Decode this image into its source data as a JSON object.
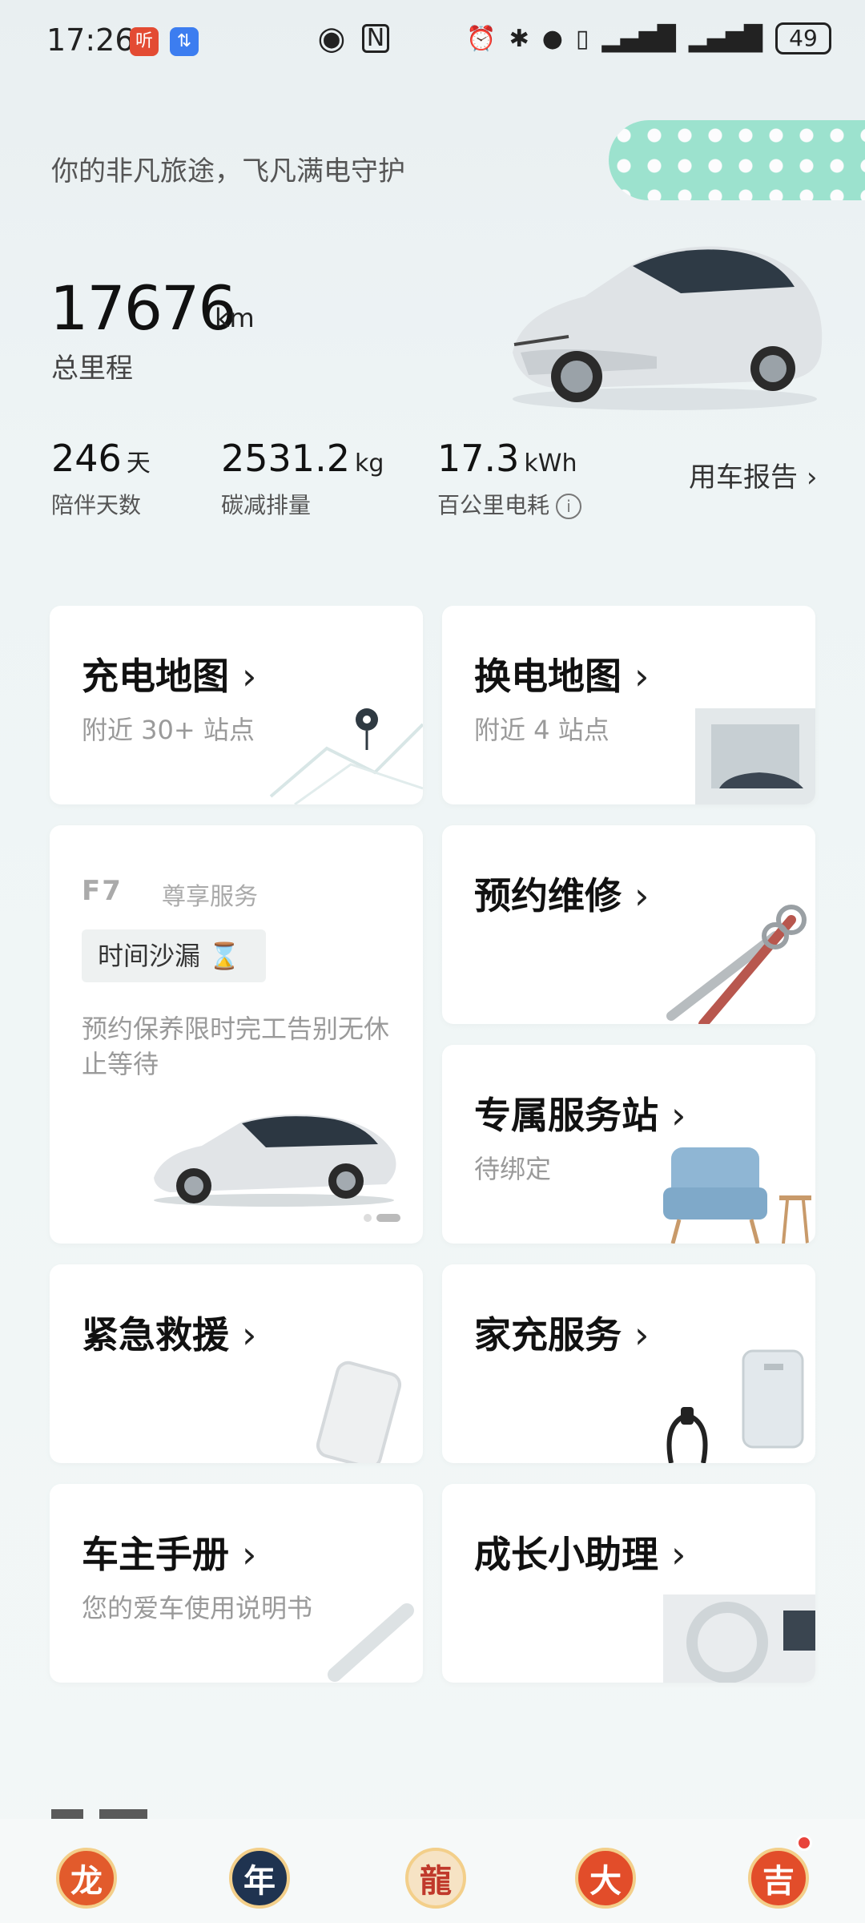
{
  "status_bar": {
    "time": "17:26",
    "battery": "49"
  },
  "header": {
    "tagline": "你的非凡旅途，飞凡满电守护",
    "mileage_value": "17676",
    "mileage_unit": "km",
    "mileage_label": "总里程"
  },
  "stats": [
    {
      "value": "246",
      "unit": "天",
      "label": "陪伴天数"
    },
    {
      "value": "2531.2",
      "unit": "kg",
      "label": "碳减排量"
    },
    {
      "value": "17.3",
      "unit": "kWh",
      "label": "百公里电耗"
    }
  ],
  "report_link": "用车报告",
  "cards": {
    "charge": {
      "title": "充电地图",
      "sub": "附近 30+ 站点"
    },
    "swap": {
      "title": "换电地图",
      "sub": "附近 4 站点"
    },
    "f7": {
      "logo": "F7",
      "tag": "尊享服务",
      "chip": "时间沙漏",
      "desc": "预约保养限时完工告别无休止等待"
    },
    "repair": {
      "title": "预约维修"
    },
    "station": {
      "title": "专属服务站",
      "sub": "待绑定"
    },
    "rescue": {
      "title": "紧急救援"
    },
    "home": {
      "title": "家充服务"
    },
    "manual": {
      "title": "车主手册",
      "sub": "您的爱车使用说明书"
    },
    "growth": {
      "title": "成长小助理"
    }
  },
  "tabs": [
    "龙",
    "年",
    "",
    "大",
    "吉"
  ],
  "icons": {
    "chevron": "chevron-right-icon",
    "info": "info-icon",
    "hourglass": "hourglass-icon"
  }
}
